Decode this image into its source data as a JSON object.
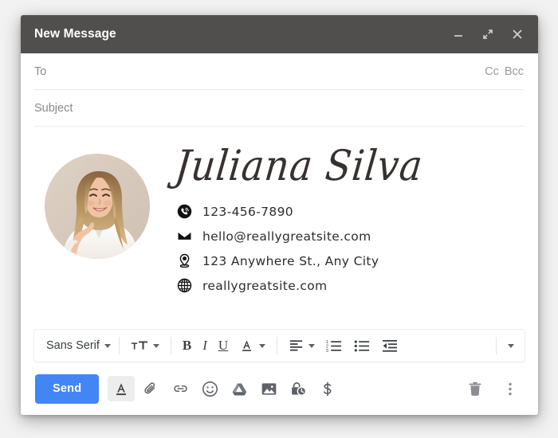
{
  "window": {
    "title": "New Message",
    "controls": [
      {
        "name": "minimize-button",
        "icon": "minimize-icon"
      },
      {
        "name": "expand-button",
        "icon": "expand-icon"
      },
      {
        "name": "close-button",
        "icon": "close-icon"
      }
    ]
  },
  "fields": {
    "to": {
      "label": "To",
      "value": "",
      "placeholder": "To"
    },
    "cc": "Cc",
    "bcc": "Bcc",
    "subject": {
      "label": "Subject",
      "value": "",
      "placeholder": "Subject"
    }
  },
  "signature": {
    "name": "Juliana Silva",
    "avatar_alt": "portrait-photo",
    "contacts": [
      {
        "icon": "phone-icon",
        "text": "123-456-7890"
      },
      {
        "icon": "email-icon",
        "text": "hello@reallygreatsite.com"
      },
      {
        "icon": "location-icon",
        "text": "123 Anywhere St., Any City"
      },
      {
        "icon": "website-icon",
        "text": "reallygreatsite.com"
      }
    ]
  },
  "format_toolbar": {
    "font": "Sans Serif",
    "items": [
      {
        "name": "font-size-button",
        "icon": "font-size-icon"
      },
      {
        "name": "bold-button",
        "label": "B"
      },
      {
        "name": "italic-button",
        "label": "I"
      },
      {
        "name": "underline-button",
        "label": "U"
      },
      {
        "name": "text-color-button",
        "label": "A"
      },
      {
        "name": "align-button",
        "icon": "align-left-icon"
      },
      {
        "name": "numbered-list-button",
        "icon": "numbered-list-icon"
      },
      {
        "name": "bulleted-list-button",
        "icon": "bulleted-list-icon"
      },
      {
        "name": "indent-less-button",
        "icon": "indent-decrease-icon"
      },
      {
        "name": "more-format-button",
        "icon": "chevron-down-icon"
      }
    ]
  },
  "bottom_bar": {
    "send_label": "Send",
    "actions": [
      {
        "name": "formatting-options-button",
        "icon": "text-format-icon",
        "active": true
      },
      {
        "name": "attach-file-button",
        "icon": "paperclip-icon"
      },
      {
        "name": "insert-link-button",
        "icon": "link-icon"
      },
      {
        "name": "insert-emoji-button",
        "icon": "emoji-icon"
      },
      {
        "name": "insert-drive-button",
        "icon": "google-drive-icon"
      },
      {
        "name": "insert-photo-button",
        "icon": "image-icon"
      },
      {
        "name": "confidential-mode-button",
        "icon": "lock-clock-icon"
      },
      {
        "name": "insert-money-button",
        "icon": "dollar-icon"
      }
    ],
    "right_actions": [
      {
        "name": "discard-draft-button",
        "icon": "trash-icon"
      },
      {
        "name": "more-options-button",
        "icon": "more-vertical-icon"
      }
    ]
  },
  "colors": {
    "titlebar": "#514f4e",
    "send_blue": "#4285f4",
    "placeholder_gray": "#8a8a8a",
    "text_dark": "#2d2d2d"
  }
}
